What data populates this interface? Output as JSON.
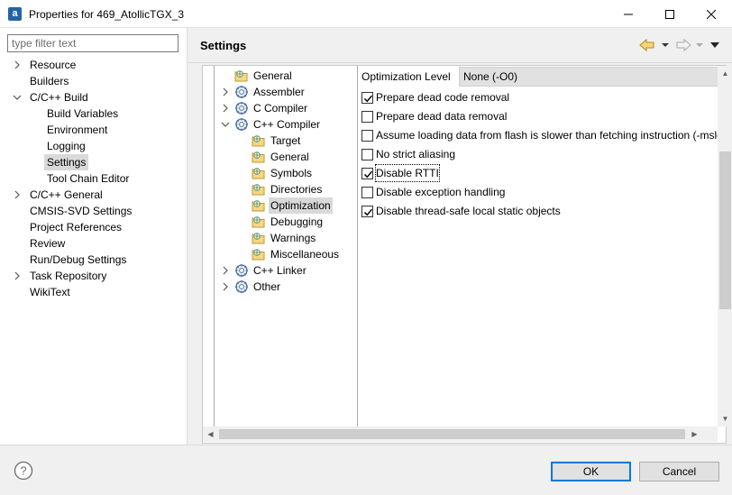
{
  "window": {
    "title": "Properties for 469_AtollicTGX_3",
    "icon_letter": "a"
  },
  "filter": {
    "placeholder": "type filter text"
  },
  "nav": {
    "items": [
      {
        "label": "Resource",
        "expander": "collapsed",
        "indent": 0
      },
      {
        "label": "Builders",
        "expander": "none",
        "indent": 0
      },
      {
        "label": "C/C++ Build",
        "expander": "expanded",
        "indent": 0
      },
      {
        "label": "Build Variables",
        "expander": "none",
        "indent": 1
      },
      {
        "label": "Environment",
        "expander": "none",
        "indent": 1
      },
      {
        "label": "Logging",
        "expander": "none",
        "indent": 1
      },
      {
        "label": "Settings",
        "expander": "none",
        "indent": 1,
        "selected": true
      },
      {
        "label": "Tool Chain Editor",
        "expander": "none",
        "indent": 1
      },
      {
        "label": "C/C++ General",
        "expander": "collapsed",
        "indent": 0
      },
      {
        "label": "CMSIS-SVD Settings",
        "expander": "none",
        "indent": 0
      },
      {
        "label": "Project References",
        "expander": "none",
        "indent": 0
      },
      {
        "label": "Review",
        "expander": "none",
        "indent": 0
      },
      {
        "label": "Run/Debug Settings",
        "expander": "none",
        "indent": 0
      },
      {
        "label": "Task Repository",
        "expander": "collapsed",
        "indent": 0
      },
      {
        "label": "WikiText",
        "expander": "none",
        "indent": 0
      }
    ]
  },
  "page": {
    "title": "Settings"
  },
  "tool_tree": {
    "items": [
      {
        "label": "General",
        "icon": "folder-settings-icon",
        "expander": "none",
        "indent": 0
      },
      {
        "label": "Assembler",
        "icon": "tool-gear-icon",
        "expander": "collapsed",
        "indent": 0
      },
      {
        "label": "C Compiler",
        "icon": "tool-gear-icon",
        "expander": "collapsed",
        "indent": 0
      },
      {
        "label": "C++ Compiler",
        "icon": "tool-gear-icon",
        "expander": "expanded",
        "indent": 0
      },
      {
        "label": "Target",
        "icon": "folder-settings-icon",
        "expander": "none",
        "indent": 1
      },
      {
        "label": "General",
        "icon": "folder-settings-icon",
        "expander": "none",
        "indent": 1
      },
      {
        "label": "Symbols",
        "icon": "folder-settings-icon",
        "expander": "none",
        "indent": 1
      },
      {
        "label": "Directories",
        "icon": "folder-settings-icon",
        "expander": "none",
        "indent": 1
      },
      {
        "label": "Optimization",
        "icon": "folder-settings-icon",
        "expander": "none",
        "indent": 1,
        "selected": true
      },
      {
        "label": "Debugging",
        "icon": "folder-settings-icon",
        "expander": "none",
        "indent": 1
      },
      {
        "label": "Warnings",
        "icon": "folder-settings-icon",
        "expander": "none",
        "indent": 1
      },
      {
        "label": "Miscellaneous",
        "icon": "folder-settings-icon",
        "expander": "none",
        "indent": 1
      },
      {
        "label": "C++ Linker",
        "icon": "tool-gear-icon",
        "expander": "collapsed",
        "indent": 0
      },
      {
        "label": "Other",
        "icon": "tool-gear-icon",
        "expander": "collapsed",
        "indent": 0
      }
    ]
  },
  "optimization": {
    "level_label": "Optimization Level",
    "level_value": "None (-O0)",
    "options": [
      {
        "label": "Prepare dead code removal",
        "checked": true
      },
      {
        "label": "Prepare dead data removal",
        "checked": false
      },
      {
        "label": "Assume loading data from flash is slower than fetching instruction (-mslow-flash-data)",
        "checked": false
      },
      {
        "label": "No strict aliasing",
        "checked": false
      },
      {
        "label": "Disable RTTI",
        "checked": true,
        "focused": true
      },
      {
        "label": "Disable exception handling",
        "checked": false
      },
      {
        "label": "Disable thread-safe local static objects",
        "checked": true
      }
    ]
  },
  "buttons": {
    "ok": "OK",
    "cancel": "Cancel"
  }
}
